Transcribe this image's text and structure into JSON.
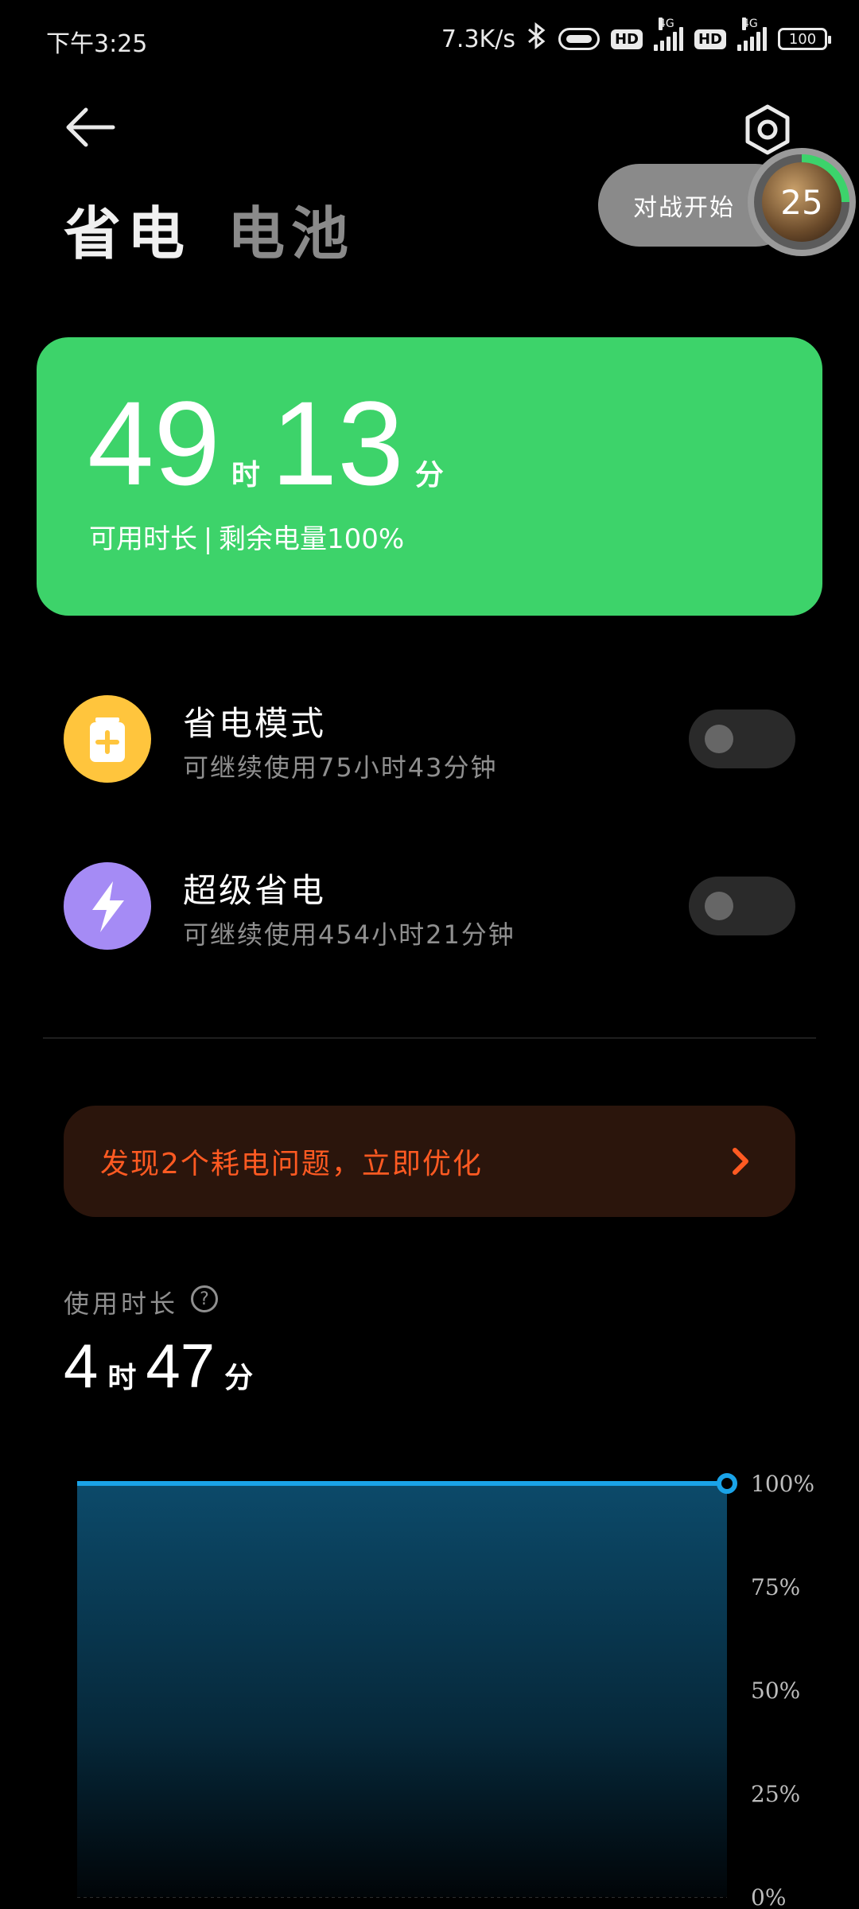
{
  "status_bar": {
    "time": "下午3:25",
    "net_speed": "7.3K/s",
    "hd1": "HD",
    "hd2": "HD",
    "net_type1": "4G",
    "net_type2": "4G",
    "battery": "100"
  },
  "header": {
    "tab_active": "省电",
    "tab_inactive": "电池"
  },
  "game_overlay": {
    "label": "对战开始",
    "count": "25"
  },
  "battery_card": {
    "hours": "49",
    "hour_unit": "时",
    "minutes": "13",
    "minute_unit": "分",
    "label": "可用时长",
    "remaining": "剩余电量100%"
  },
  "modes": [
    {
      "title": "省电模式",
      "subtitle": "可继续使用75小时43分钟",
      "enabled": false,
      "icon": "battery-plus-icon",
      "color": "#ffc53d"
    },
    {
      "title": "超级省电",
      "subtitle": "可继续使用454小时21分钟",
      "enabled": false,
      "icon": "lightning-icon",
      "color": "#a58bf5"
    }
  ],
  "alert": {
    "text": "发现2个耗电问题，立即优化"
  },
  "usage": {
    "label": "使用时长",
    "hours": "4",
    "hour_unit": "时",
    "minutes": "47",
    "minute_unit": "分"
  },
  "chart_data": {
    "type": "area",
    "y_ticks": [
      "100%",
      "75%",
      "50%",
      "25%",
      "0%"
    ],
    "ylim": [
      0,
      100
    ],
    "values": [
      100,
      100
    ],
    "line_color": "#1aa3e8",
    "grid": true
  },
  "colors": {
    "accent_green": "#3dd36a",
    "alert_text": "#ff5a22"
  }
}
